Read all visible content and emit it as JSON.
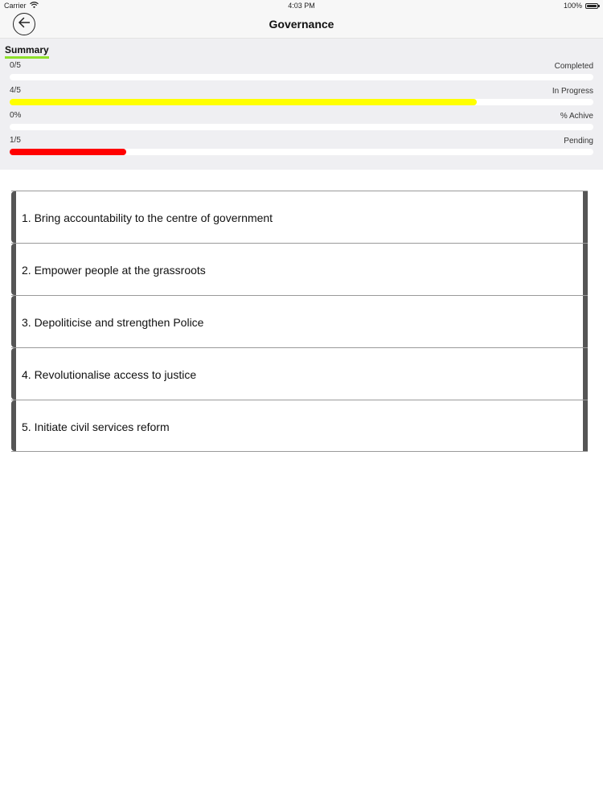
{
  "status_bar": {
    "carrier": "Carrier",
    "time": "4:03 PM",
    "battery": "100%"
  },
  "nav": {
    "title": "Governance"
  },
  "summary": {
    "title": "Summary",
    "stats": [
      {
        "value": "0/5",
        "label": "Completed",
        "progress": 0.0,
        "color": "#cccccc"
      },
      {
        "value": "4/5",
        "label": "In Progress",
        "progress": 0.8,
        "color": "#ffff00"
      },
      {
        "value": "0%",
        "label": "% Achive",
        "progress": 0.0,
        "color": "#cccccc"
      },
      {
        "value": "1/5",
        "label": "Pending",
        "progress": 0.2,
        "color": "#ff0000"
      }
    ]
  },
  "goals": [
    {
      "label": "1. Bring accountability to the centre of government"
    },
    {
      "label": "2. Empower people at the grassroots"
    },
    {
      "label": "3. Depoliticise and strengthen Police"
    },
    {
      "label": "4. Revolutionalise access to justice"
    },
    {
      "label": "5. Initiate civil services reform"
    }
  ],
  "icons": {
    "back": "arrow-left-icon",
    "wifi": "wifi-icon",
    "battery": "battery-icon"
  }
}
